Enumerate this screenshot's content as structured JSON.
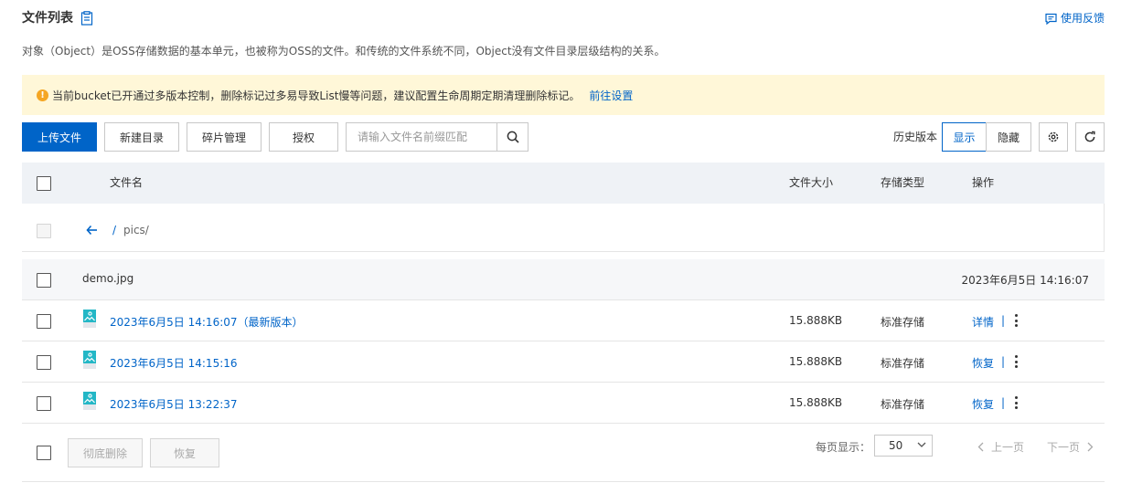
{
  "header": {
    "title": "文件列表",
    "feedback_label": "使用反馈",
    "description": "对象（Object）是OSS存储数据的基本单元，也被称为OSS的文件。和传统的文件系统不同，Object没有文件目录层级结构的关系。"
  },
  "notice": {
    "text": "当前bucket已开通过多版本控制，删除标记过多易导致List慢等问题，建议配置生命周期定期清理删除标记。",
    "link_label": "前往设置"
  },
  "toolbar": {
    "upload_label": "上传文件",
    "new_dir_label": "新建目录",
    "fragment_label": "碎片管理",
    "auth_label": "授权",
    "search_placeholder": "请输入文件名前缀匹配",
    "history_label": "历史版本",
    "show_label": "显示",
    "hide_label": "隐藏"
  },
  "table": {
    "columns": {
      "name": "文件名",
      "size": "文件大小",
      "storage": "存储类型",
      "action": "操作"
    },
    "nav": {
      "root": "/",
      "path": "pics/"
    },
    "group": {
      "name": "demo.jpg",
      "modified": "2023年6月5日 14:16:07"
    },
    "versions": [
      {
        "name": "2023年6月5日 14:16:07（最新版本）",
        "size": "15.888KB",
        "storage": "标准存储",
        "action": "详情"
      },
      {
        "name": "2023年6月5日 14:15:16",
        "size": "15.888KB",
        "storage": "标准存储",
        "action": "恢复"
      },
      {
        "name": "2023年6月5日 13:22:37",
        "size": "15.888KB",
        "storage": "标准存储",
        "action": "恢复"
      }
    ],
    "separator": "|"
  },
  "footer": {
    "delete_label": "彻底删除",
    "restore_label": "恢复",
    "page_size_label": "每页显示：",
    "page_size_value": "50",
    "prev_label": "上一页",
    "next_label": "下一页"
  },
  "colors": {
    "primary": "#0064c8",
    "notice_bg": "#fff7d8",
    "warning": "#f5a623",
    "header_bg": "#eff2f6"
  }
}
